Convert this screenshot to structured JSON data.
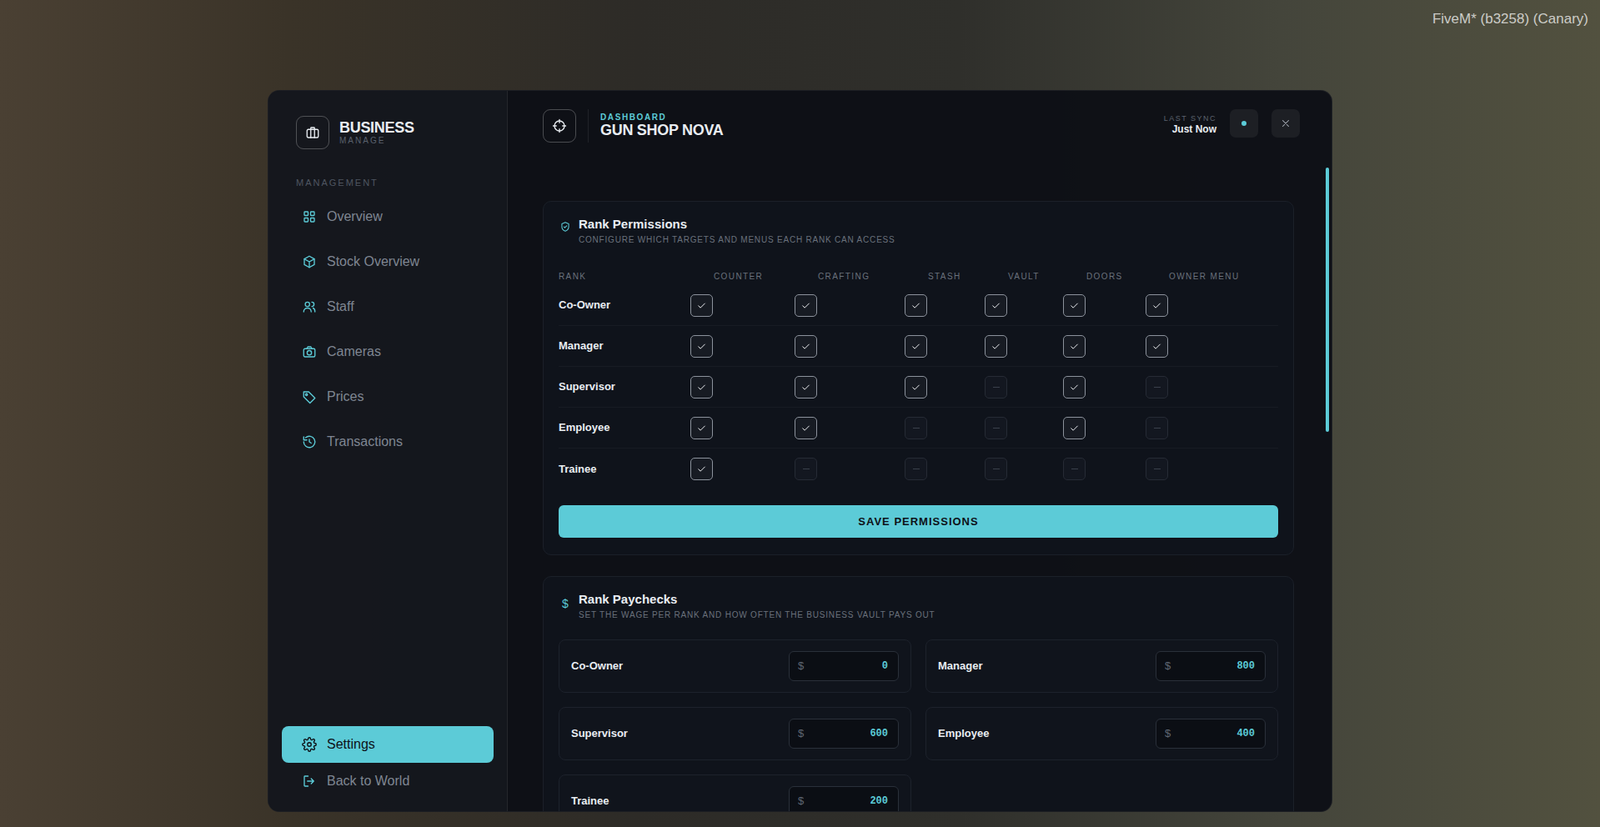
{
  "client_label": "FiveM* (b3258) (Canary)",
  "sidebar": {
    "title": "BUSINESS",
    "subtitle": "MANAGE",
    "section": "MANAGEMENT",
    "items": [
      {
        "label": "Overview",
        "selected": false
      },
      {
        "label": "Stock Overview",
        "selected": false
      },
      {
        "label": "Staff",
        "selected": false
      },
      {
        "label": "Cameras",
        "selected": false
      },
      {
        "label": "Prices",
        "selected": false
      },
      {
        "label": "Transactions",
        "selected": false
      }
    ],
    "footer_items": [
      {
        "label": "Settings",
        "selected": true
      },
      {
        "label": "Back to World",
        "selected": false
      }
    ]
  },
  "header": {
    "eyebrow": "DASHBOARD",
    "title": "GUN SHOP NOVA",
    "sync_label": "LAST SYNC",
    "sync_value": "Just Now",
    "sync_online": true
  },
  "permissions": {
    "title": "Rank Permissions",
    "subtitle": "CONFIGURE WHICH TARGETS AND MENUS EACH RANK CAN ACCESS",
    "columns": [
      "RANK",
      "COUNTER",
      "CRAFTING",
      "STASH",
      "VAULT",
      "DOORS",
      "OWNER MENU"
    ],
    "rows": [
      {
        "rank": "Co-Owner",
        "access": [
          true,
          true,
          true,
          true,
          true,
          true
        ]
      },
      {
        "rank": "Manager",
        "access": [
          true,
          true,
          true,
          true,
          true,
          true
        ]
      },
      {
        "rank": "Supervisor",
        "access": [
          true,
          true,
          true,
          false,
          true,
          false
        ]
      },
      {
        "rank": "Employee",
        "access": [
          true,
          true,
          false,
          false,
          true,
          false
        ]
      },
      {
        "rank": "Trainee",
        "access": [
          true,
          false,
          false,
          false,
          false,
          false
        ]
      }
    ],
    "save_button": "SAVE PERMISSIONS"
  },
  "paychecks": {
    "icon": "$",
    "title": "Rank Paychecks",
    "subtitle": "SET THE WAGE PER RANK AND HOW OFTEN THE BUSINESS VAULT PAYS OUT",
    "currency": "$",
    "rows": [
      {
        "rank": "Co-Owner",
        "wage": "0"
      },
      {
        "rank": "Manager",
        "wage": "800"
      },
      {
        "rank": "Supervisor",
        "wage": "600"
      },
      {
        "rank": "Employee",
        "wage": "400"
      },
      {
        "rank": "Trainee",
        "wage": "200"
      }
    ]
  },
  "scrollbar": {
    "level": 0.41
  }
}
